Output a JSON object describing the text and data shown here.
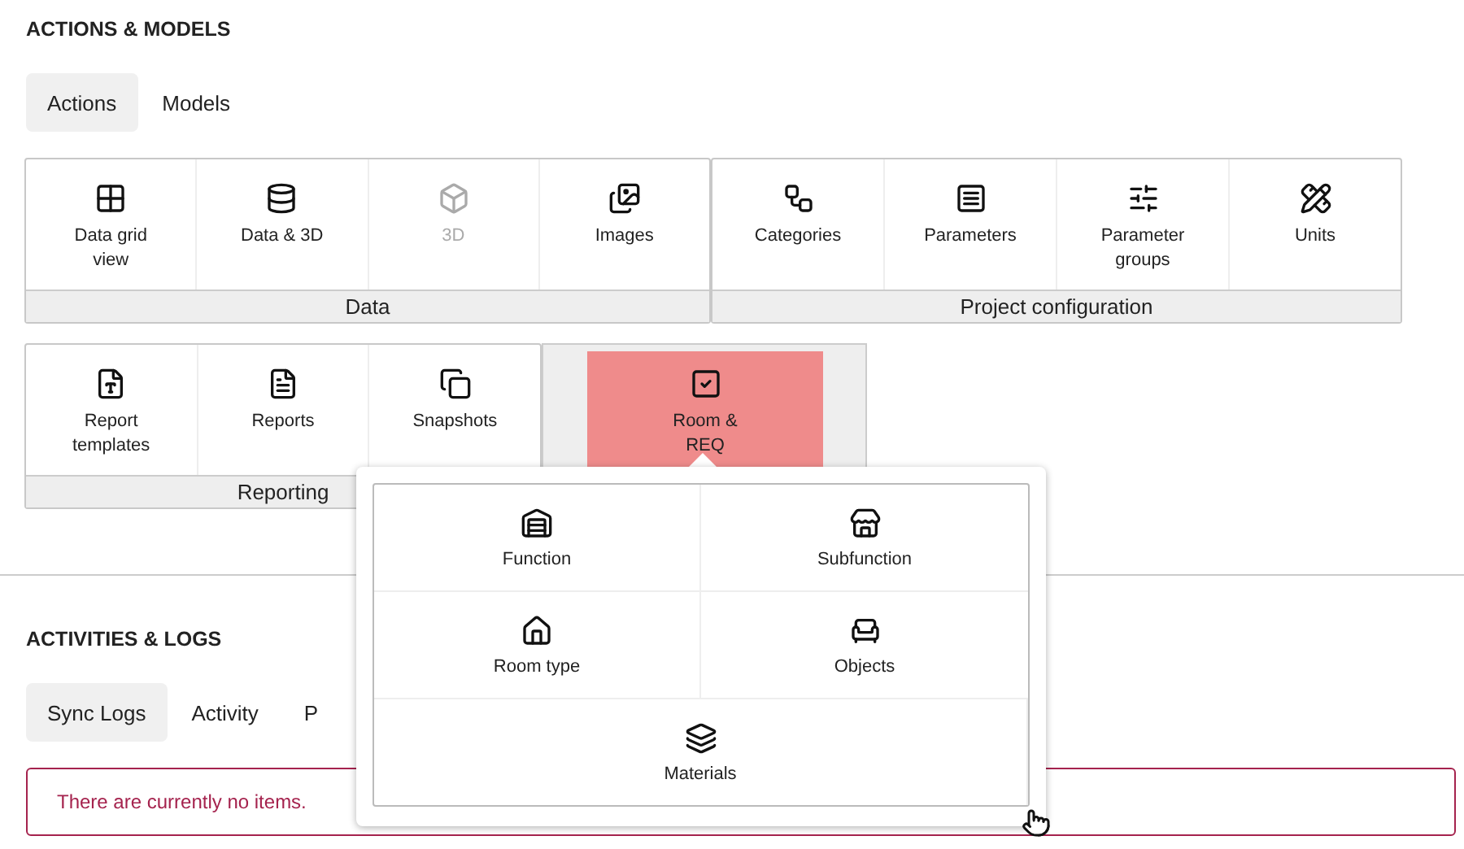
{
  "sections": [
    {
      "title": "ACTIONS & MODELS",
      "tabs": [
        {
          "label": "Actions",
          "selected": true
        },
        {
          "label": "Models",
          "selected": false
        }
      ]
    },
    {
      "title": "ACTIVITIES & LOGS",
      "tabs": [
        {
          "label": "Sync Logs",
          "selected": true
        },
        {
          "label": "Activity",
          "selected": false
        },
        {
          "label": "P",
          "selected": false
        }
      ]
    }
  ],
  "group_rows": [
    [
      {
        "label": "Data",
        "items": [
          {
            "label": "Data grid view",
            "disabled": false
          },
          {
            "label": "Data & 3D",
            "disabled": false
          },
          {
            "label": "3D",
            "disabled": true
          },
          {
            "label": "Images",
            "disabled": false
          }
        ]
      },
      {
        "label": "Project configuration",
        "items": [
          {
            "label": "Categories",
            "disabled": false
          },
          {
            "label": "Parameters",
            "disabled": false
          },
          {
            "label": "Parameter groups",
            "disabled": false
          },
          {
            "label": "Units",
            "disabled": false
          }
        ]
      }
    ],
    [
      {
        "label": "Reporting",
        "items": [
          {
            "label": "Report templates",
            "disabled": false
          },
          {
            "label": "Reports",
            "disabled": false
          },
          {
            "label": "Snapshots",
            "disabled": false
          }
        ]
      },
      {
        "items": [
          {
            "label": "Room & REQ",
            "selected": true
          }
        ]
      }
    ]
  ],
  "popup": {
    "items": [
      {
        "label": "Function"
      },
      {
        "label": "Subfunction"
      },
      {
        "label": "Room type"
      },
      {
        "label": "Objects"
      },
      {
        "label": "Materials"
      }
    ]
  },
  "alert": {
    "text": "There are currently no items."
  }
}
